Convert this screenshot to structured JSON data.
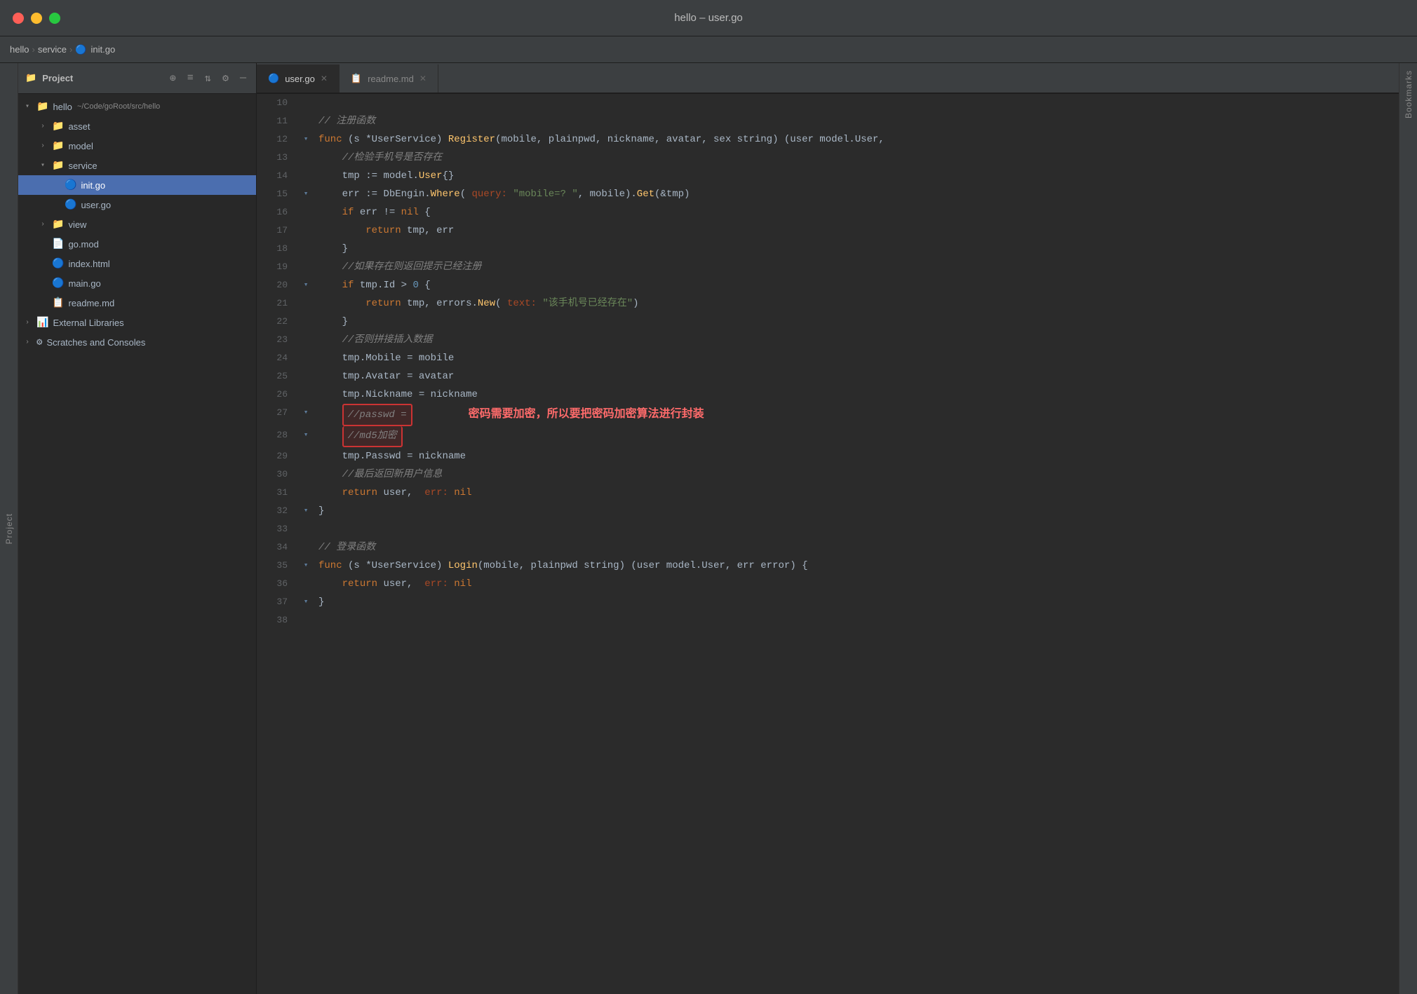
{
  "titlebar": {
    "title": "hello – user.go",
    "buttons": [
      "close",
      "minimize",
      "maximize"
    ]
  },
  "breadcrumb": {
    "items": [
      "hello",
      "service",
      "init.go"
    ]
  },
  "sidebar": {
    "toolbar_title": "Project",
    "root": "hello",
    "root_path": "~/Code/goRoot/src/hello",
    "items": [
      {
        "label": "asset",
        "type": "folder",
        "indent": 1,
        "expanded": false
      },
      {
        "label": "model",
        "type": "folder",
        "indent": 1,
        "expanded": false
      },
      {
        "label": "service",
        "type": "folder",
        "indent": 1,
        "expanded": true
      },
      {
        "label": "init.go",
        "type": "file-go",
        "indent": 2,
        "selected": true
      },
      {
        "label": "user.go",
        "type": "file-go",
        "indent": 2
      },
      {
        "label": "view",
        "type": "folder",
        "indent": 1,
        "expanded": false
      },
      {
        "label": "go.mod",
        "type": "file",
        "indent": 1
      },
      {
        "label": "index.html",
        "type": "file-html",
        "indent": 1
      },
      {
        "label": "main.go",
        "type": "file-go",
        "indent": 1
      },
      {
        "label": "readme.md",
        "type": "file-md",
        "indent": 1
      },
      {
        "label": "External Libraries",
        "type": "special",
        "indent": 0
      },
      {
        "label": "Scratches and Consoles",
        "type": "special",
        "indent": 0
      }
    ]
  },
  "tabs": [
    {
      "label": "user.go",
      "active": true,
      "icon": "go"
    },
    {
      "label": "readme.md",
      "active": false,
      "icon": "md"
    }
  ],
  "code": {
    "lines": [
      {
        "num": 10,
        "gutter": "",
        "content": ""
      },
      {
        "num": 11,
        "gutter": "",
        "content": "// 注册函数"
      },
      {
        "num": 12,
        "gutter": "▾",
        "content": "func (s *UserService) Register(mobile, plainpwd, nickname, avatar, sex string) (user model.User,"
      },
      {
        "num": 13,
        "gutter": "",
        "content": "    //检验手机号是否存在"
      },
      {
        "num": 14,
        "gutter": "",
        "content": "    tmp := model.User{}"
      },
      {
        "num": 15,
        "gutter": "▾",
        "content": "    err := DbEngin.Where( query: \"mobile=? \", mobile).Get(&tmp)"
      },
      {
        "num": 16,
        "gutter": "",
        "content": "    if err != nil {"
      },
      {
        "num": 17,
        "gutter": "",
        "content": "        return tmp, err"
      },
      {
        "num": 18,
        "gutter": "",
        "content": "    }"
      },
      {
        "num": 19,
        "gutter": "",
        "content": "    //如果存在则返回提示已经注册"
      },
      {
        "num": 20,
        "gutter": "▾",
        "content": "    if tmp.Id > 0 {"
      },
      {
        "num": 21,
        "gutter": "",
        "content": "        return tmp, errors.New( text: \"该手机号已经存在\")"
      },
      {
        "num": 22,
        "gutter": "",
        "content": "    }"
      },
      {
        "num": 23,
        "gutter": "",
        "content": "    //否则拼接插入数据"
      },
      {
        "num": 24,
        "gutter": "",
        "content": "    tmp.Mobile = mobile"
      },
      {
        "num": 25,
        "gutter": "",
        "content": "    tmp.Avatar = avatar"
      },
      {
        "num": 26,
        "gutter": "",
        "content": "    tmp.Nickname = nickname"
      },
      {
        "num": 27,
        "gutter": "▾",
        "content_highlighted": true,
        "content": "    //passwd ="
      },
      {
        "num": 28,
        "gutter": "▾",
        "content_highlighted": true,
        "content": "    //md5加密"
      },
      {
        "num": 29,
        "gutter": "",
        "content": "    tmp.Passwd = nickname"
      },
      {
        "num": 30,
        "gutter": "",
        "content": "    //最后返回新用户信息"
      },
      {
        "num": 31,
        "gutter": "",
        "content": "    return user,  err: nil"
      },
      {
        "num": 32,
        "gutter": "▾",
        "content": "}"
      },
      {
        "num": 33,
        "gutter": "",
        "content": ""
      },
      {
        "num": 34,
        "gutter": "",
        "content": "// 登录函数"
      },
      {
        "num": 35,
        "gutter": "▾",
        "content": "func (s *UserService) Login(mobile, plainpwd string) (user model.User, err error) {"
      },
      {
        "num": 36,
        "gutter": "",
        "content": "    return user,  err: nil"
      },
      {
        "num": 37,
        "gutter": "▾",
        "content": "}"
      },
      {
        "num": 38,
        "gutter": "",
        "content": ""
      }
    ],
    "annotation": "密码需要加密，所以要把密码加密算法进行封装"
  },
  "sidebar_label": "Project",
  "bookmarks_label": "Bookmarks"
}
